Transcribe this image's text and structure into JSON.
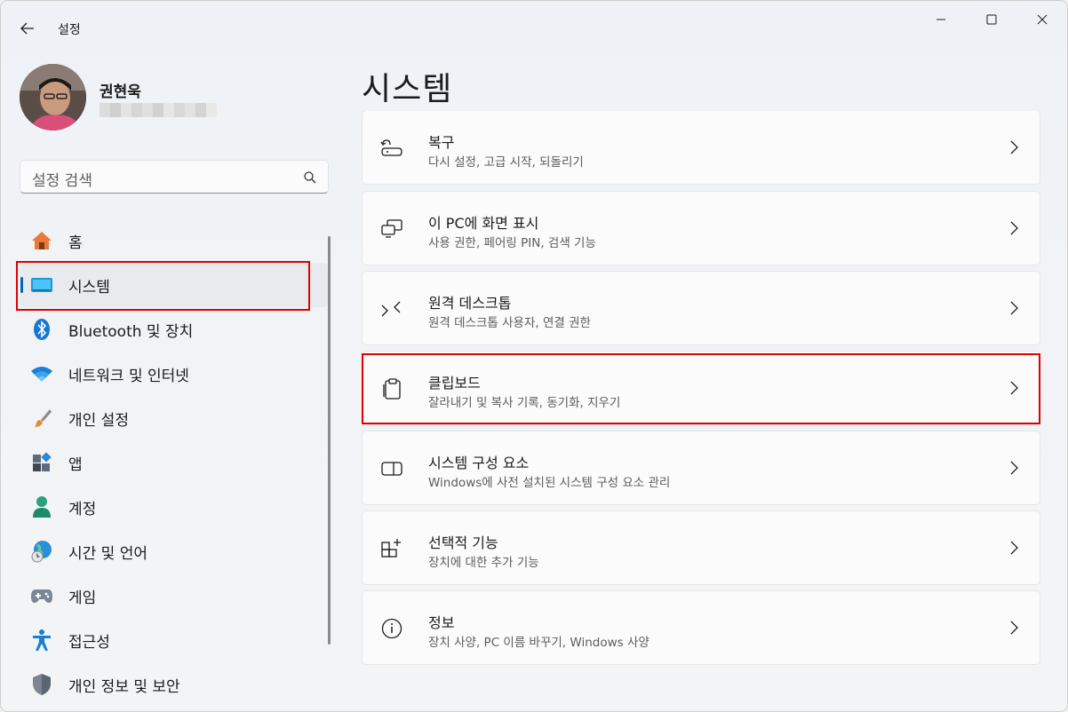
{
  "window": {
    "title": "설정"
  },
  "user": {
    "name": "권현욱"
  },
  "search": {
    "placeholder": "설정 검색"
  },
  "nav": {
    "items": [
      {
        "label": "홈",
        "icon": "home-icon"
      },
      {
        "label": "시스템",
        "icon": "system-icon",
        "active": true
      },
      {
        "label": "Bluetooth 및 장치",
        "icon": "bluetooth-icon"
      },
      {
        "label": "네트워크 및 인터넷",
        "icon": "network-icon"
      },
      {
        "label": "개인 설정",
        "icon": "brush-icon"
      },
      {
        "label": "앱",
        "icon": "apps-icon"
      },
      {
        "label": "계정",
        "icon": "account-icon"
      },
      {
        "label": "시간 및 언어",
        "icon": "time-language-icon"
      },
      {
        "label": "게임",
        "icon": "gaming-icon"
      },
      {
        "label": "접근성",
        "icon": "accessibility-icon"
      },
      {
        "label": "개인 정보 및 보안",
        "icon": "shield-icon"
      }
    ]
  },
  "main": {
    "title": "시스템",
    "cards": [
      {
        "title": "복구",
        "desc": "다시 설정, 고급 시작, 되돌리기",
        "icon": "recovery-icon"
      },
      {
        "title": "이 PC에 화면 표시",
        "desc": "사용 권한, 페어링 PIN, 검색 기능",
        "icon": "project-icon"
      },
      {
        "title": "원격 데스크톱",
        "desc": "원격 데스크톱 사용자, 연결 권한",
        "icon": "remote-desktop-icon"
      },
      {
        "title": "클립보드",
        "desc": "잘라내기 및 복사 기록, 동기화, 지우기",
        "icon": "clipboard-icon"
      },
      {
        "title": "시스템 구성 요소",
        "desc": "Windows에 사전 설치된 시스템 구성 요소 관리",
        "icon": "components-icon"
      },
      {
        "title": "선택적 기능",
        "desc": "장치에 대한 추가 기능",
        "icon": "optional-features-icon"
      },
      {
        "title": "정보",
        "desc": "장치 사양, PC 이름 바꾸기, Windows 사양",
        "icon": "info-icon"
      }
    ]
  },
  "colors": {
    "accent": "#0067c0",
    "highlight": "#e00000"
  }
}
